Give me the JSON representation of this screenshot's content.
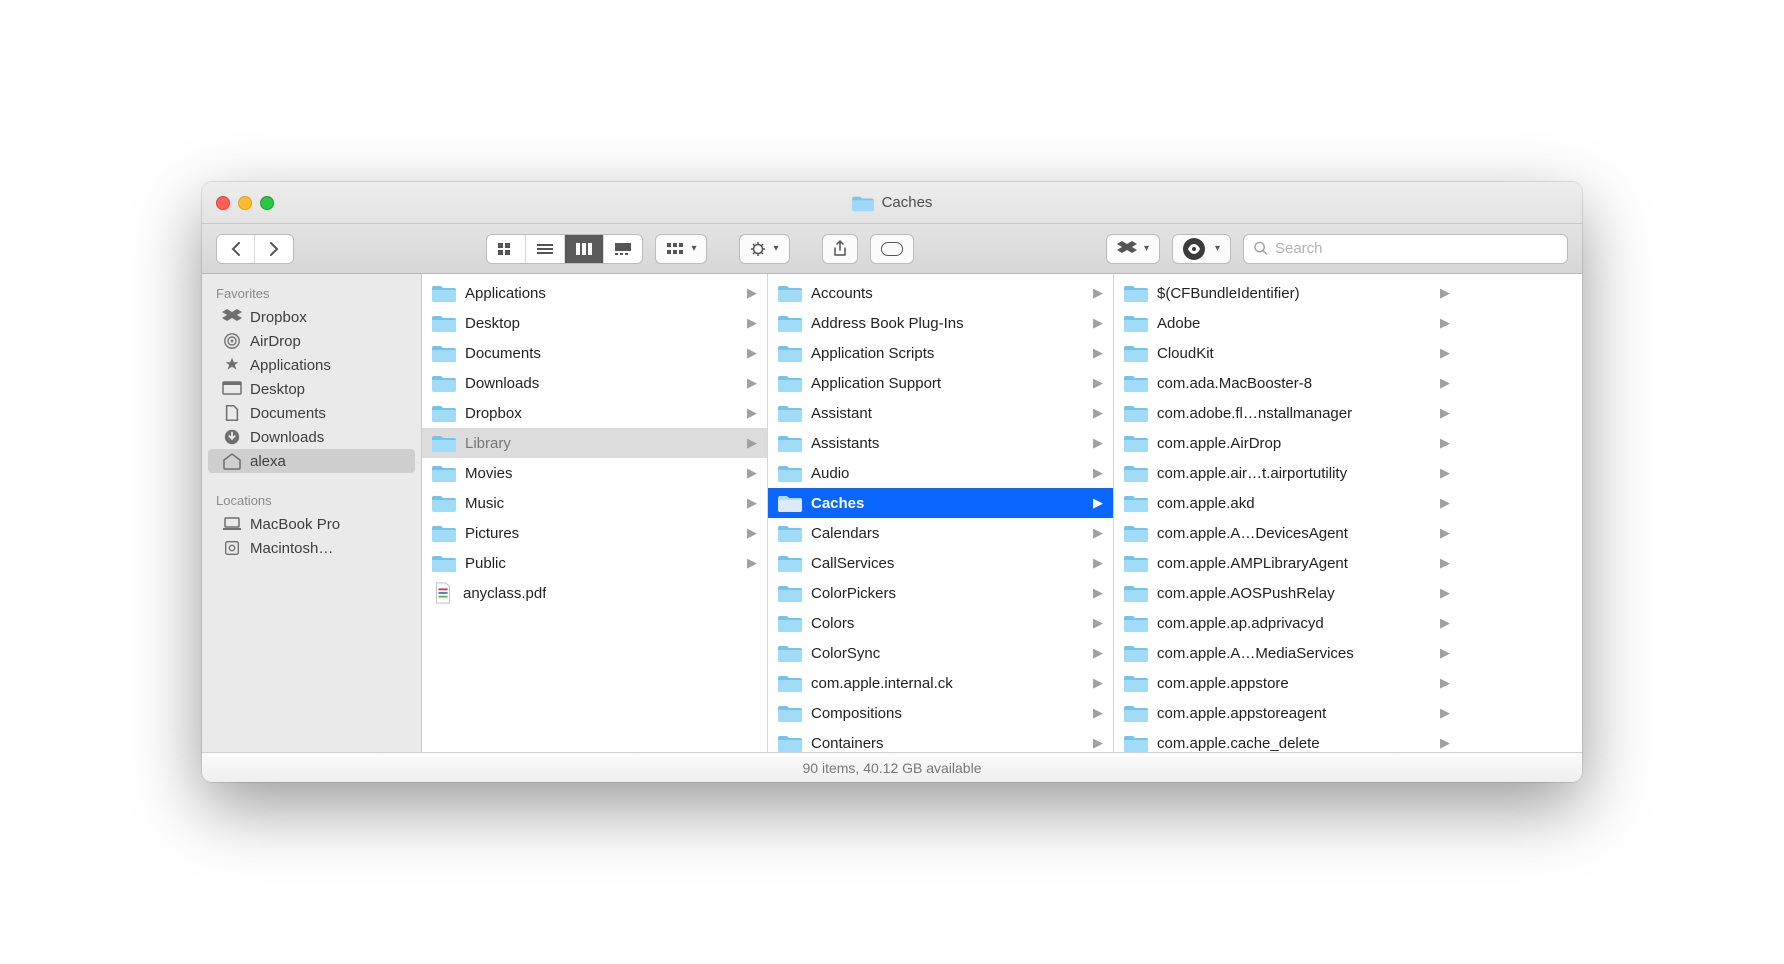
{
  "window": {
    "title": "Caches"
  },
  "search": {
    "placeholder": "Search"
  },
  "sidebar": {
    "sections": [
      {
        "heading": "Favorites",
        "items": [
          {
            "label": "Dropbox",
            "icon": "dropbox"
          },
          {
            "label": "AirDrop",
            "icon": "airdrop"
          },
          {
            "label": "Applications",
            "icon": "applications"
          },
          {
            "label": "Desktop",
            "icon": "desktop"
          },
          {
            "label": "Documents",
            "icon": "documents"
          },
          {
            "label": "Downloads",
            "icon": "downloads"
          },
          {
            "label": "alexa",
            "icon": "home",
            "selected": true
          }
        ]
      },
      {
        "heading": "Locations",
        "items": [
          {
            "label": "MacBook Pro",
            "icon": "laptop"
          },
          {
            "label": "Macintosh…",
            "icon": "disk"
          }
        ]
      }
    ]
  },
  "columns": [
    {
      "items": [
        {
          "label": "Applications",
          "type": "folder",
          "arrow": true
        },
        {
          "label": "Desktop",
          "type": "folder",
          "arrow": true
        },
        {
          "label": "Documents",
          "type": "folder",
          "arrow": true
        },
        {
          "label": "Downloads",
          "type": "folder",
          "arrow": true
        },
        {
          "label": "Dropbox",
          "type": "folder",
          "arrow": true
        },
        {
          "label": "Library",
          "type": "folder",
          "arrow": true,
          "selected": "dim"
        },
        {
          "label": "Movies",
          "type": "folder",
          "arrow": true
        },
        {
          "label": "Music",
          "type": "folder",
          "arrow": true
        },
        {
          "label": "Pictures",
          "type": "folder",
          "arrow": true
        },
        {
          "label": "Public",
          "type": "folder",
          "arrow": true
        },
        {
          "label": "anyclass.pdf",
          "type": "file",
          "arrow": false
        }
      ]
    },
    {
      "items": [
        {
          "label": "Accounts",
          "type": "folder",
          "arrow": true
        },
        {
          "label": "Address Book Plug-Ins",
          "type": "folder",
          "arrow": true
        },
        {
          "label": "Application Scripts",
          "type": "folder",
          "arrow": true
        },
        {
          "label": "Application Support",
          "type": "folder",
          "arrow": true
        },
        {
          "label": "Assistant",
          "type": "folder",
          "arrow": true
        },
        {
          "label": "Assistants",
          "type": "folder",
          "arrow": true
        },
        {
          "label": "Audio",
          "type": "folder",
          "arrow": true
        },
        {
          "label": "Caches",
          "type": "folder",
          "arrow": true,
          "selected": "blue"
        },
        {
          "label": "Calendars",
          "type": "folder",
          "arrow": true
        },
        {
          "label": "CallServices",
          "type": "folder",
          "arrow": true
        },
        {
          "label": "ColorPickers",
          "type": "folder",
          "arrow": true
        },
        {
          "label": "Colors",
          "type": "folder",
          "arrow": true
        },
        {
          "label": "ColorSync",
          "type": "folder",
          "arrow": true
        },
        {
          "label": "com.apple.internal.ck",
          "type": "folder",
          "arrow": true
        },
        {
          "label": "Compositions",
          "type": "folder",
          "arrow": true
        },
        {
          "label": "Containers",
          "type": "folder",
          "arrow": true
        }
      ]
    },
    {
      "items": [
        {
          "label": "$(CFBundleIdentifier)",
          "type": "folder",
          "arrow": true
        },
        {
          "label": "Adobe",
          "type": "folder",
          "arrow": true
        },
        {
          "label": "CloudKit",
          "type": "folder",
          "arrow": true
        },
        {
          "label": "com.ada.MacBooster-8",
          "type": "folder",
          "arrow": true
        },
        {
          "label": "com.adobe.fl…nstallmanager",
          "type": "folder",
          "arrow": true
        },
        {
          "label": "com.apple.AirDrop",
          "type": "folder",
          "arrow": true
        },
        {
          "label": "com.apple.air…t.airportutility",
          "type": "folder",
          "arrow": true
        },
        {
          "label": "com.apple.akd",
          "type": "folder",
          "arrow": true
        },
        {
          "label": "com.apple.A…DevicesAgent",
          "type": "folder",
          "arrow": true
        },
        {
          "label": "com.apple.AMPLibraryAgent",
          "type": "folder",
          "arrow": true
        },
        {
          "label": "com.apple.AOSPushRelay",
          "type": "folder",
          "arrow": true
        },
        {
          "label": "com.apple.ap.adprivacyd",
          "type": "folder",
          "arrow": true
        },
        {
          "label": "com.apple.A…MediaServices",
          "type": "folder",
          "arrow": true
        },
        {
          "label": "com.apple.appstore",
          "type": "folder",
          "arrow": true
        },
        {
          "label": "com.apple.appstoreagent",
          "type": "folder",
          "arrow": true
        },
        {
          "label": "com.apple.cache_delete",
          "type": "folder",
          "arrow": true
        }
      ]
    }
  ],
  "status": {
    "text": "90 items, 40.12 GB available"
  }
}
